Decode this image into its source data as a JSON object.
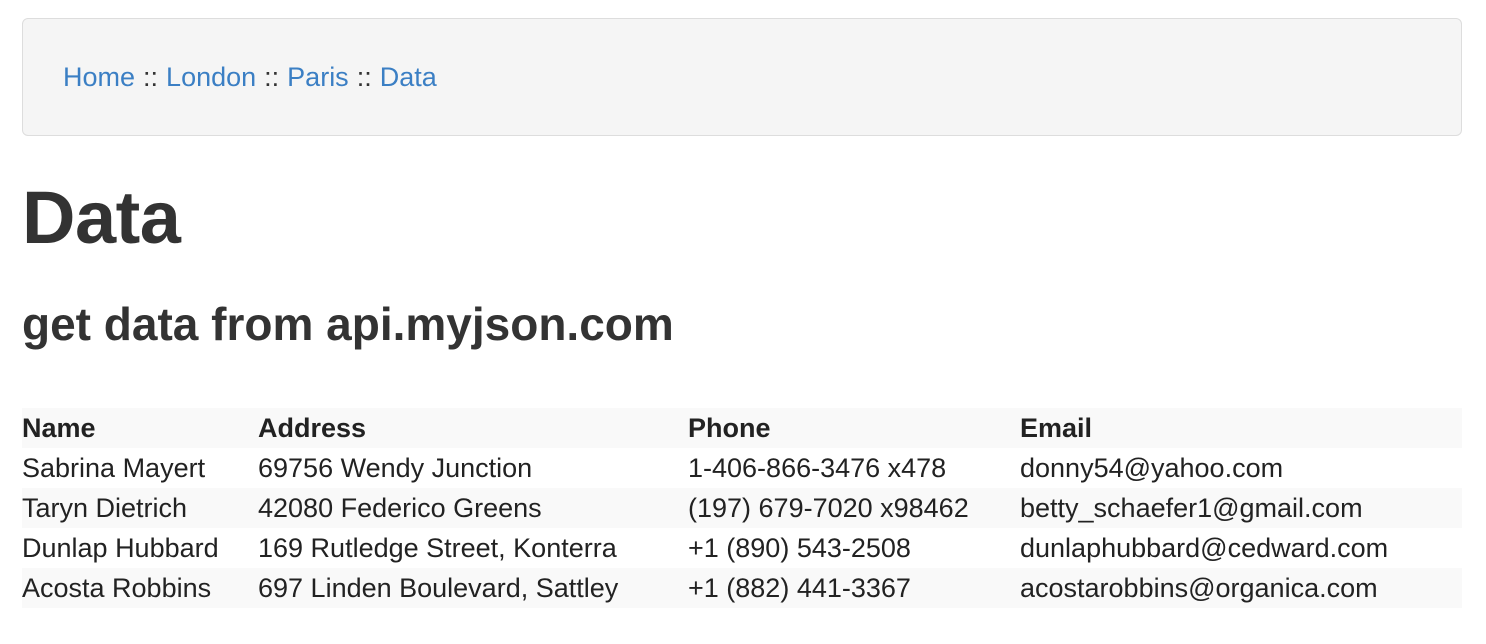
{
  "breadcrumb": {
    "separator": "::",
    "items": [
      {
        "label": "Home"
      },
      {
        "label": "London"
      },
      {
        "label": "Paris"
      },
      {
        "label": "Data"
      }
    ]
  },
  "page": {
    "title": "Data",
    "subtitle": "get data from api.myjson.com"
  },
  "table": {
    "headers": [
      "Name",
      "Address",
      "Phone",
      "Email"
    ],
    "rows": [
      [
        "Sabrina Mayert",
        "69756 Wendy Junction",
        "1-406-866-3476 x478",
        "donny54@yahoo.com"
      ],
      [
        "Taryn Dietrich",
        "42080 Federico Greens",
        "(197) 679-7020 x98462",
        "betty_schaefer1@gmail.com"
      ],
      [
        "Dunlap Hubbard",
        "169 Rutledge Street, Konterra",
        "+1 (890) 543-2508",
        "dunlaphubbard@cedward.com"
      ],
      [
        "Acosta Robbins",
        "697 Linden Boulevard, Sattley",
        "+1 (882) 441-3367",
        "acostarobbins@organica.com"
      ]
    ]
  }
}
